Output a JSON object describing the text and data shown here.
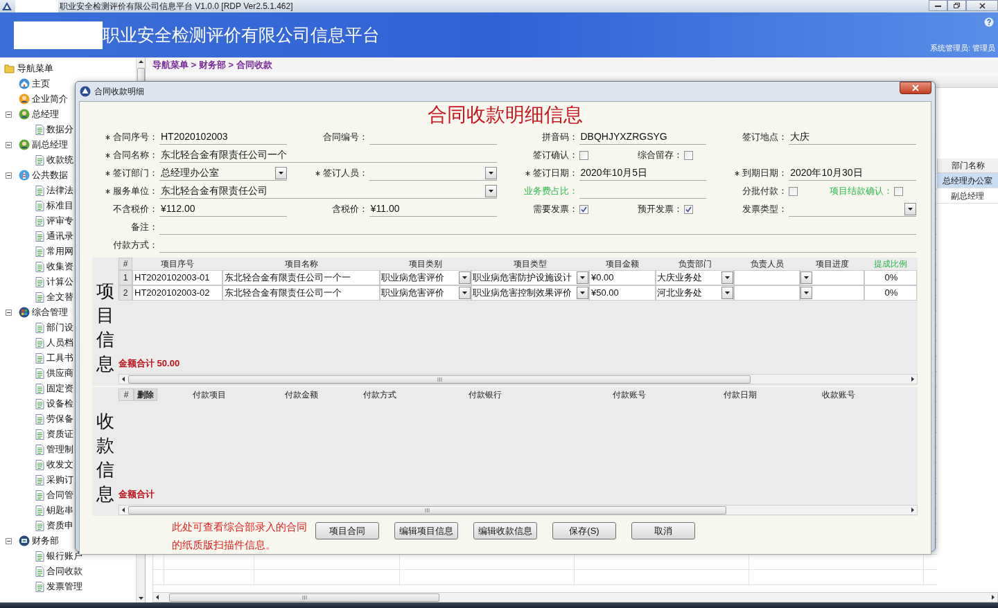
{
  "app_title": "职业安全检测评价有限公司信息平台 V1.0.0 [RDP Ver2.5.1.462]",
  "banner": {
    "title": "职业安全检测评价有限公司信息平台",
    "user": "系统管理员: 管理员"
  },
  "nav": {
    "label": "导航菜单",
    "kind": "folder",
    "children": [
      {
        "label": "主页",
        "kind": "home"
      },
      {
        "label": "企业简介",
        "kind": "company"
      },
      {
        "label": "总经理",
        "kind": "manager",
        "expanded": true,
        "children": [
          {
            "label": "数据分",
            "kind": "doc"
          }
        ]
      },
      {
        "label": "副总经理",
        "kind": "manager",
        "expanded": true,
        "children": [
          {
            "label": "收款统",
            "kind": "doc"
          }
        ]
      },
      {
        "label": "公共数据",
        "kind": "public",
        "expanded": true,
        "children": [
          {
            "label": "法律法",
            "kind": "doc"
          },
          {
            "label": "标准目",
            "kind": "doc"
          },
          {
            "label": "评审专",
            "kind": "doc"
          },
          {
            "label": "通讯录",
            "kind": "doc"
          },
          {
            "label": "常用网",
            "kind": "doc"
          },
          {
            "label": "收集资",
            "kind": "doc"
          },
          {
            "label": "计算公",
            "kind": "doc"
          },
          {
            "label": "全文替",
            "kind": "doc"
          }
        ]
      },
      {
        "label": "综合管理",
        "kind": "manage",
        "expanded": true,
        "children": [
          {
            "label": "部门设",
            "kind": "doc"
          },
          {
            "label": "人员档",
            "kind": "doc"
          },
          {
            "label": "工具书",
            "kind": "doc"
          },
          {
            "label": "供应商",
            "kind": "doc"
          },
          {
            "label": "固定资",
            "kind": "doc"
          },
          {
            "label": "设备检",
            "kind": "doc"
          },
          {
            "label": "劳保备",
            "kind": "doc"
          },
          {
            "label": "资质证",
            "kind": "doc"
          },
          {
            "label": "管理制",
            "kind": "doc"
          },
          {
            "label": "收发文",
            "kind": "doc"
          },
          {
            "label": "采购订",
            "kind": "doc"
          },
          {
            "label": "合同管",
            "kind": "doc"
          },
          {
            "label": "钥匙串",
            "kind": "doc"
          },
          {
            "label": "资质申",
            "kind": "doc"
          }
        ]
      },
      {
        "label": "财务部",
        "kind": "finance",
        "expanded": true,
        "children": [
          {
            "label": "银行账户",
            "kind": "doc"
          },
          {
            "label": "合同收款",
            "kind": "doc"
          },
          {
            "label": "发票管理",
            "kind": "doc"
          }
        ]
      }
    ]
  },
  "breadcrumb": "导航菜单 > 财务部 > 合同收款",
  "dept_grid": {
    "column": "部门名称",
    "rows": [
      {
        "name": "总经理办公室",
        "selected": true
      },
      {
        "name": "副总经理",
        "selected": false
      }
    ]
  },
  "dialog": {
    "title": "合同收款明细",
    "heading": "合同收款明细信息",
    "form": [
      [
        {
          "label": "合同序号：",
          "required": true,
          "kind": "text",
          "value": "HT2020102003"
        },
        {
          "label": "合同编号：",
          "required": false,
          "kind": "text"
        },
        {
          "label": "拼音码：",
          "required": false,
          "kind": "text",
          "value": "DBQHJYXZRGSYG"
        },
        {
          "label": "签订地点：",
          "required": false,
          "kind": "text",
          "value": "大庆"
        }
      ],
      [
        {
          "label": "合同名称：",
          "required": true,
          "kind": "text",
          "wide": true,
          "value": "东北轻合金有限责任公司一个"
        },
        {
          "label": "签订确认：",
          "required": false,
          "kind": "check",
          "checked": false
        },
        {
          "label": "综合留存：",
          "required": false,
          "kind": "check",
          "checked": false
        }
      ],
      [
        {
          "label": "签订部门：",
          "required": true,
          "kind": "select",
          "value": "总经理办公室"
        },
        {
          "label": "签订人员：",
          "required": true,
          "kind": "select"
        },
        {
          "label": "签订日期：",
          "required": true,
          "kind": "text",
          "value": "2020年10月5日"
        },
        {
          "label": "到期日期：",
          "required": true,
          "kind": "text",
          "value": "2020年10月30日"
        }
      ],
      [
        {
          "label": "服务单位：",
          "required": true,
          "kind": "select",
          "wide": true,
          "value": "东北轻合金有限责任公司"
        },
        {
          "label": "业务费占比：",
          "required": false,
          "kind": "text",
          "color": "#2eb84c"
        },
        {
          "label": "分批付款：",
          "required": false,
          "kind": "check",
          "checked": false
        },
        {
          "label": "项目结款确认：",
          "required": false,
          "kind": "check",
          "checked": false,
          "color": "#2eb84c"
        }
      ],
      [
        {
          "label": "不含税价：",
          "required": false,
          "kind": "text",
          "value": "¥112.00"
        },
        {
          "label": "含税价：",
          "required": false,
          "kind": "text",
          "value": "¥11.00"
        },
        {
          "label": "需要发票：",
          "required": false,
          "kind": "check",
          "checked": true
        },
        {
          "label": "预开发票：",
          "required": false,
          "kind": "check",
          "checked": true
        },
        {
          "label": "发票类型：",
          "required": false,
          "kind": "select"
        }
      ],
      [
        {
          "label": "备注：",
          "required": false,
          "kind": "text"
        }
      ],
      [
        {
          "label": "付款方式：",
          "required": false,
          "kind": "text"
        }
      ]
    ],
    "items": {
      "label": "项目信息",
      "columns": [
        {
          "label": "#",
          "kind": "index"
        },
        {
          "label": "项目序号",
          "kind": "text"
        },
        {
          "label": "项目名称",
          "kind": "text"
        },
        {
          "label": "项目类别",
          "kind": "select"
        },
        {
          "label": "项目类型",
          "kind": "select"
        },
        {
          "label": "项目金额",
          "kind": "text"
        },
        {
          "label": "负责部门",
          "kind": "select"
        },
        {
          "label": "负责人员",
          "kind": "text"
        },
        {
          "label": "项目进度",
          "kind": "select"
        },
        {
          "label": "提成比例",
          "kind": "percent",
          "color": "#2eb84c"
        }
      ],
      "rows": [
        {
          "cells": [
            "1",
            "HT2020102003-01",
            "东北轻合金有限责任公司一个一",
            "职业病危害评价",
            "职业病危害防护设施设计",
            "¥0.00",
            "大庆业务处",
            null,
            null,
            "0%"
          ]
        },
        {
          "cells": [
            "2",
            "HT2020102003-02",
            "东北轻合金有限责任公司一个",
            "职业病危害评价",
            "职业病危害控制效果评价",
            "¥50.00",
            "河北业务处",
            null,
            null,
            "0%"
          ]
        }
      ],
      "total": "金额合计 50.00"
    },
    "payments": {
      "label": "收款信息",
      "columns": [
        {
          "label": "#",
          "kind": "index"
        },
        {
          "label": "删除",
          "kind": "action"
        },
        {
          "label": "付款项目",
          "kind": "text"
        },
        {
          "label": "付款金额",
          "kind": "text"
        },
        {
          "label": "付款方式",
          "kind": "text"
        },
        {
          "label": "付款银行",
          "kind": "text"
        },
        {
          "label": "付款账号",
          "kind": "text"
        },
        {
          "label": "付款日期",
          "kind": "text"
        },
        {
          "label": "收款账号",
          "kind": "text"
        }
      ],
      "total": "金额合计"
    },
    "note": "此处可查看综合部录入的合同的纸质版扫描件信息。",
    "buttons": [
      "项目合同",
      "编辑项目信息",
      "编辑收款信息",
      "保存(S)",
      "取消"
    ]
  }
}
